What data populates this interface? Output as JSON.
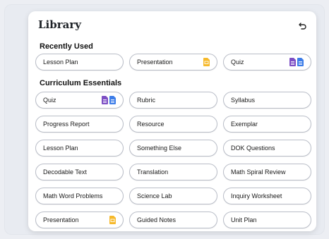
{
  "library": {
    "title": "Library",
    "recently_used": {
      "heading": "Recently Used",
      "items": [
        {
          "label": "Lesson Plan",
          "icons": []
        },
        {
          "label": "Presentation",
          "icons": [
            "slides-icon"
          ]
        },
        {
          "label": "Quiz",
          "icons": [
            "forms-icon",
            "docs-icon"
          ]
        }
      ]
    },
    "curriculum": {
      "heading": "Curriculum Essentials",
      "items": [
        {
          "label": "Quiz",
          "icons": [
            "forms-icon",
            "docs-icon"
          ]
        },
        {
          "label": "Rubric",
          "icons": []
        },
        {
          "label": "Syllabus",
          "icons": []
        },
        {
          "label": "Progress Report",
          "icons": []
        },
        {
          "label": "Resource",
          "icons": []
        },
        {
          "label": "Exemplar",
          "icons": []
        },
        {
          "label": "Lesson Plan",
          "icons": []
        },
        {
          "label": "Something Else",
          "icons": []
        },
        {
          "label": "DOK Questions",
          "icons": []
        },
        {
          "label": "Decodable Text",
          "icons": []
        },
        {
          "label": "Translation",
          "icons": []
        },
        {
          "label": "Math Spiral Review",
          "icons": []
        },
        {
          "label": "Math Word Problems",
          "icons": []
        },
        {
          "label": "Science Lab",
          "icons": []
        },
        {
          "label": "Inquiry Worksheet",
          "icons": []
        },
        {
          "label": "Presentation",
          "icons": [
            "slides-icon"
          ]
        },
        {
          "label": "Guided Notes",
          "icons": []
        },
        {
          "label": "Unit Plan",
          "icons": []
        }
      ]
    }
  },
  "colors": {
    "slides": "#f6b92b",
    "forms": "#7d4fc4",
    "docs": "#3d7de8"
  }
}
